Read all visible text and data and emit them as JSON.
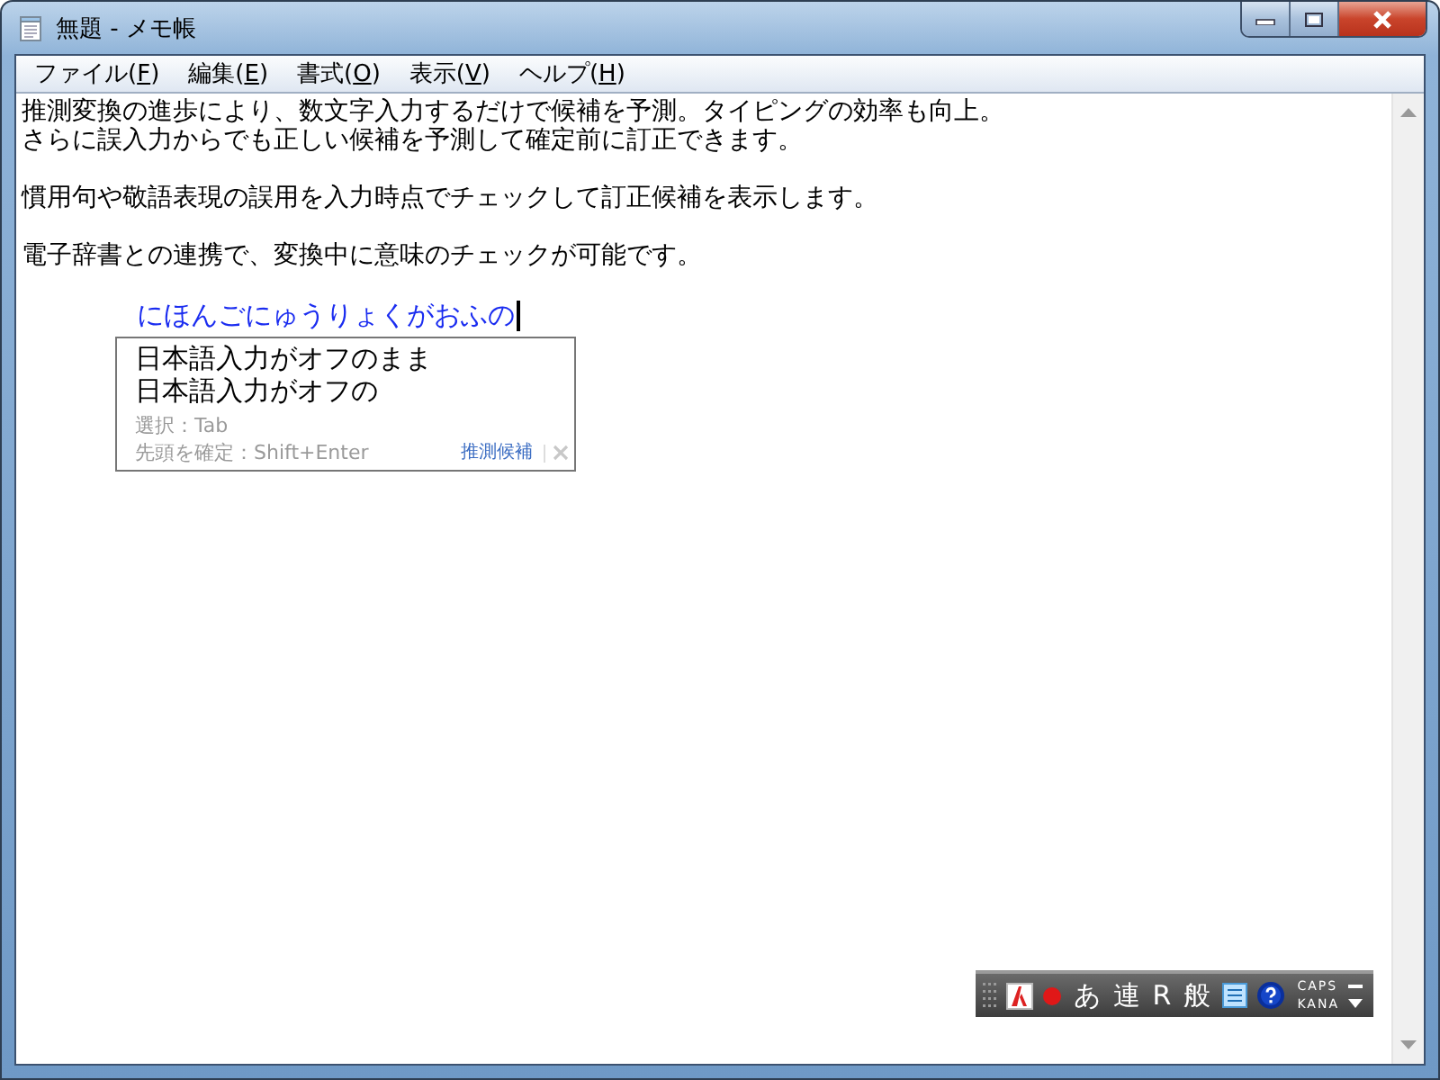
{
  "window": {
    "title": "無題 - メモ帳"
  },
  "menu": [
    {
      "label": "ファイル(",
      "key": "F",
      "tail": ")"
    },
    {
      "label": "編集(",
      "key": "E",
      "tail": ")"
    },
    {
      "label": "書式(",
      "key": "O",
      "tail": ")"
    },
    {
      "label": "表示(",
      "key": "V",
      "tail": ")"
    },
    {
      "label": "ヘルプ(",
      "key": "H",
      "tail": ")"
    }
  ],
  "document": {
    "paragraphs": [
      [
        "推測変換の進歩により、数文字入力するだけで候補を予測。タイピングの効率も向上。",
        "さらに誤入力からでも正しい候補を予測して確定前に訂正できます。"
      ],
      [
        "慣用句や敬語表現の誤用を入力時点でチェックして訂正候補を表示します。"
      ],
      [
        "電子辞書との連携で、変換中に意味のチェックが可能です。"
      ]
    ],
    "composition": "にほんごにゅうりょくがおふの"
  },
  "candidates": {
    "items": [
      "日本語入力がオフのまま",
      "日本語入力がオフの"
    ],
    "hints": [
      "選択：Tab",
      "先頭を確定：Shift+Enter"
    ],
    "link": "推測候補"
  },
  "ime_toolbar": {
    "modes": [
      "あ",
      "連",
      "R",
      "般"
    ],
    "caps": "CAPS",
    "kana": "KANA"
  }
}
